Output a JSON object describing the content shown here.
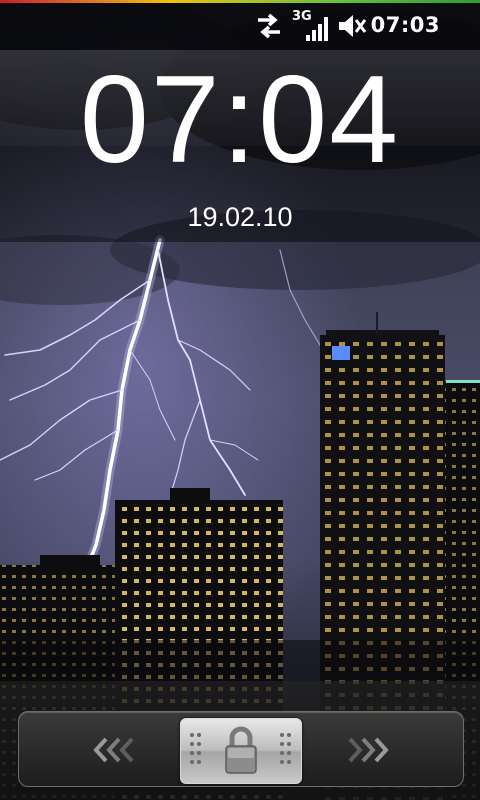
{
  "status_bar": {
    "time": "07:03",
    "network_label": "3G",
    "icons": [
      "data-transfer-icon",
      "signal-3g-icon",
      "vibrate-silent-icon"
    ]
  },
  "lockscreen": {
    "time": "07:04",
    "date": "19.02.10"
  },
  "unlock_slider": {
    "left_icon": "chevron-left-icon",
    "handle_icon": "padlock-icon",
    "right_icon": "chevron-right-icon"
  },
  "colors": {
    "text": "#ffffff",
    "status_accent_left": "#c71f2d",
    "status_accent_mid": "#f2c014",
    "status_accent_right": "#2f9a35"
  }
}
